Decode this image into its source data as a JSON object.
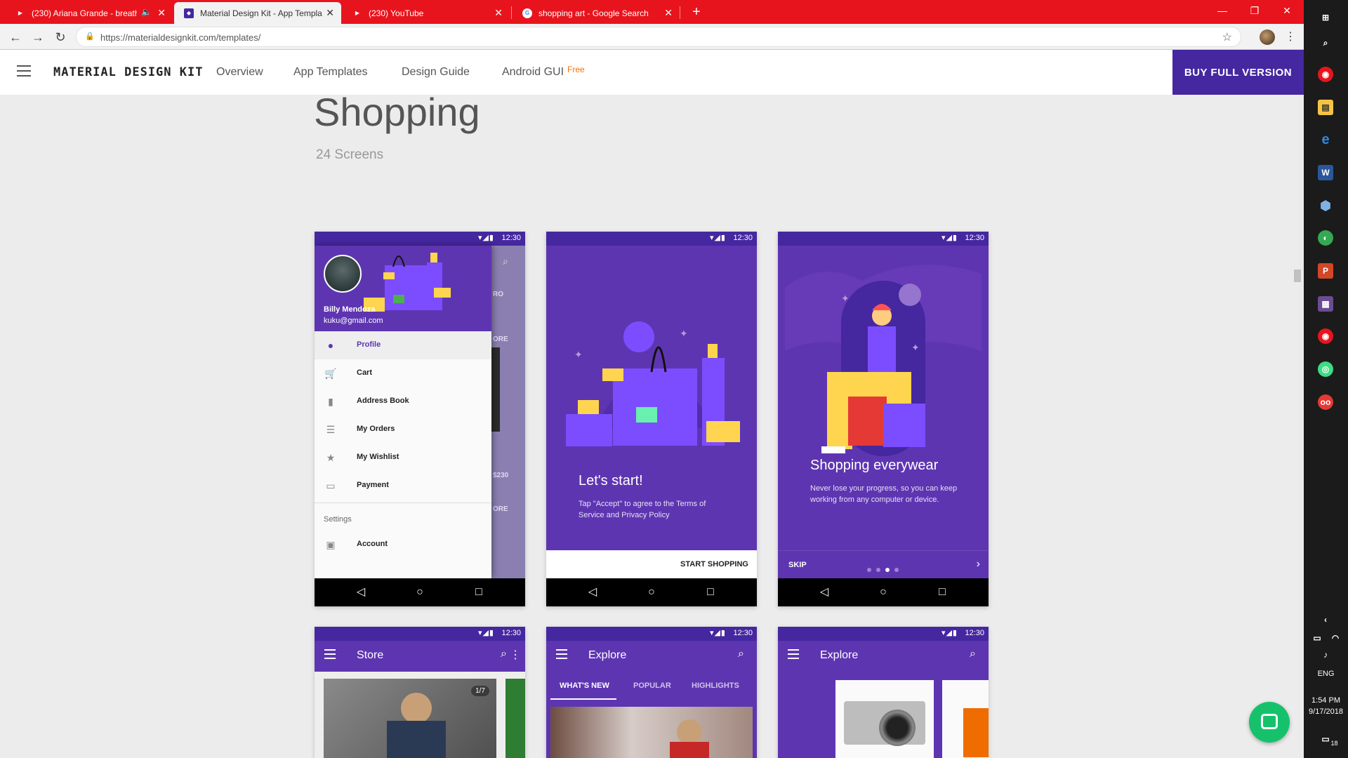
{
  "browser": {
    "tabs": [
      {
        "title": "(230) Ariana Grande - breath",
        "active": false
      },
      {
        "title": "Material Design Kit - App Templa",
        "active": true
      },
      {
        "title": "(230) YouTube",
        "active": false
      },
      {
        "title": "shopping art - Google Search",
        "active": false
      }
    ],
    "url": "https://materialdesignkit.com/templates/"
  },
  "site": {
    "brand": "MATERIAL DESIGN KIT",
    "nav": [
      "Overview",
      "App Templates",
      "Design Guide",
      "Android GUI"
    ],
    "free_badge": "Free",
    "buy_button": "BUY FULL VERSION"
  },
  "page": {
    "title": "Shopping",
    "subtitle": "24 Screens"
  },
  "phones": {
    "status_time": "12:30",
    "drawer": {
      "user_name": "Billy Mendoza",
      "user_email": "kuku@gmail.com",
      "items": [
        "Profile",
        "Cart",
        "Address Book",
        "My Orders",
        "My Wishlist",
        "Payment"
      ],
      "section": "Settings",
      "settings_items": [
        "Account"
      ],
      "behind_texts": [
        "RO",
        "ORE",
        "$230",
        "ORE"
      ]
    },
    "onboard1": {
      "title": "Let's start!",
      "body": "Tap \"Accept\" to agree to the Terms of Service and Privacy Policy",
      "cta": "START SHOPPING"
    },
    "onboard2": {
      "title": "Shopping everywear",
      "body": "Never lose your progress, so you can keep working from any computer or device.",
      "skip": "SKIP"
    },
    "store": {
      "title": "Store",
      "counter": "1/7"
    },
    "explore1": {
      "title": "Explore",
      "tabs": [
        "WHAT'S NEW",
        "POPULAR",
        "HIGHLIGHTS"
      ]
    },
    "explore2": {
      "title": "Explore"
    }
  },
  "taskbar": {
    "lang": "ENG",
    "time": "1:54 PM",
    "date": "9/17/2018",
    "notif_count": "18"
  },
  "colors": {
    "chrome_red": "#e8141d",
    "brand_purple": "#4527a0",
    "primary_purple": "#5e35b1",
    "free_orange": "#ff6d00",
    "chat_green": "#15c26b"
  }
}
